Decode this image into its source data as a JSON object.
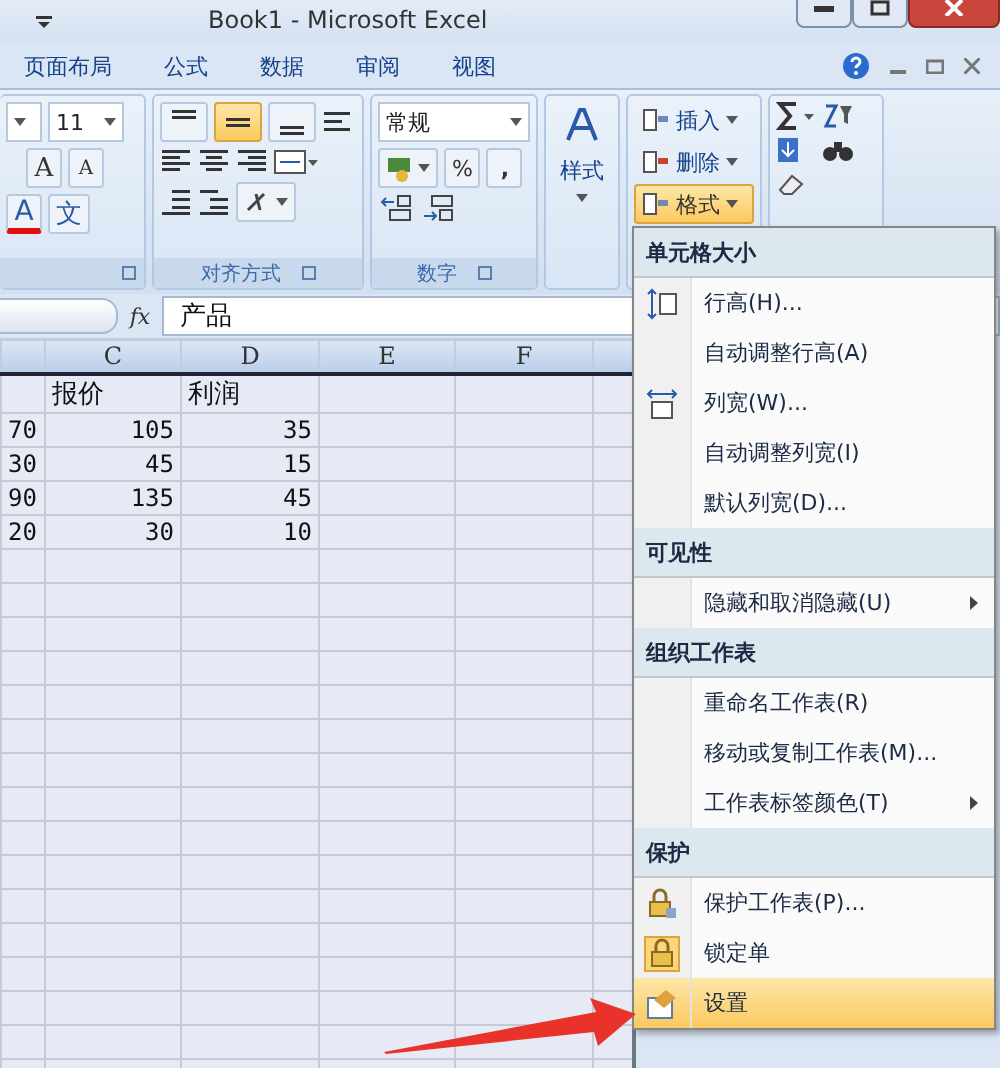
{
  "window": {
    "title": "Book1 - Microsoft Excel"
  },
  "tabs": [
    {
      "label": "页面布局",
      "selected": false
    },
    {
      "label": "公式",
      "selected": false
    },
    {
      "label": "数据",
      "selected": false
    },
    {
      "label": "审阅",
      "selected": false
    },
    {
      "label": "视图",
      "selected": false
    }
  ],
  "ribbon": {
    "font": {
      "size": "11",
      "grow": "A",
      "shrink": "A",
      "color_glyph": "A",
      "phonetic": "文"
    },
    "alignment": {
      "label": "对齐方式",
      "top_row": [
        {
          "selected": false
        },
        {
          "selected": true
        },
        {
          "selected": false
        }
      ]
    },
    "number": {
      "label": "数字",
      "format": "常规",
      "percent": "%",
      "comma": ","
    },
    "styles": {
      "label": "样式"
    },
    "cells": [
      {
        "label": "插入",
        "selected": false
      },
      {
        "label": "删除",
        "selected": false
      },
      {
        "label": "格式",
        "selected": true
      }
    ]
  },
  "formula_bar": {
    "fx": "fx",
    "content": "产品"
  },
  "sheet": {
    "columns": [
      "C",
      "D",
      "E",
      "F"
    ],
    "header_row": {
      "c": "报价",
      "d": "利润"
    },
    "rows": [
      {
        "b": "70",
        "c": "105",
        "d": "35"
      },
      {
        "b": "30",
        "c": "45",
        "d": "15"
      },
      {
        "b": "90",
        "c": "135",
        "d": "45"
      },
      {
        "b": "20",
        "c": "30",
        "d": "10"
      }
    ]
  },
  "menu": {
    "sections": [
      {
        "title": "单元格大小",
        "items": [
          {
            "label": "行高(H)...",
            "selected": false,
            "submenu": false
          },
          {
            "label": "自动调整行高(A)",
            "selected": false,
            "submenu": false
          },
          {
            "label": "列宽(W)...",
            "selected": false,
            "submenu": false
          },
          {
            "label": "自动调整列宽(I)",
            "selected": false,
            "submenu": false
          },
          {
            "label": "默认列宽(D)...",
            "selected": false,
            "submenu": false
          }
        ]
      },
      {
        "title": "可见性",
        "items": [
          {
            "label": "隐藏和取消隐藏(U)",
            "selected": false,
            "submenu": true
          }
        ]
      },
      {
        "title": "组织工作表",
        "items": [
          {
            "label": "重命名工作表(R)",
            "selected": false,
            "submenu": false
          },
          {
            "label": "移动或复制工作表(M)...",
            "selected": false,
            "submenu": false
          },
          {
            "label": "工作表标签颜色(T)",
            "selected": false,
            "submenu": true
          }
        ]
      },
      {
        "title": "保护",
        "items": [
          {
            "label": "保护工作表(P)...",
            "selected": false,
            "submenu": false
          },
          {
            "label": "锁定单",
            "selected": false,
            "submenu": false
          },
          {
            "label": "设置",
            "selected": true,
            "submenu": false
          }
        ]
      }
    ]
  }
}
